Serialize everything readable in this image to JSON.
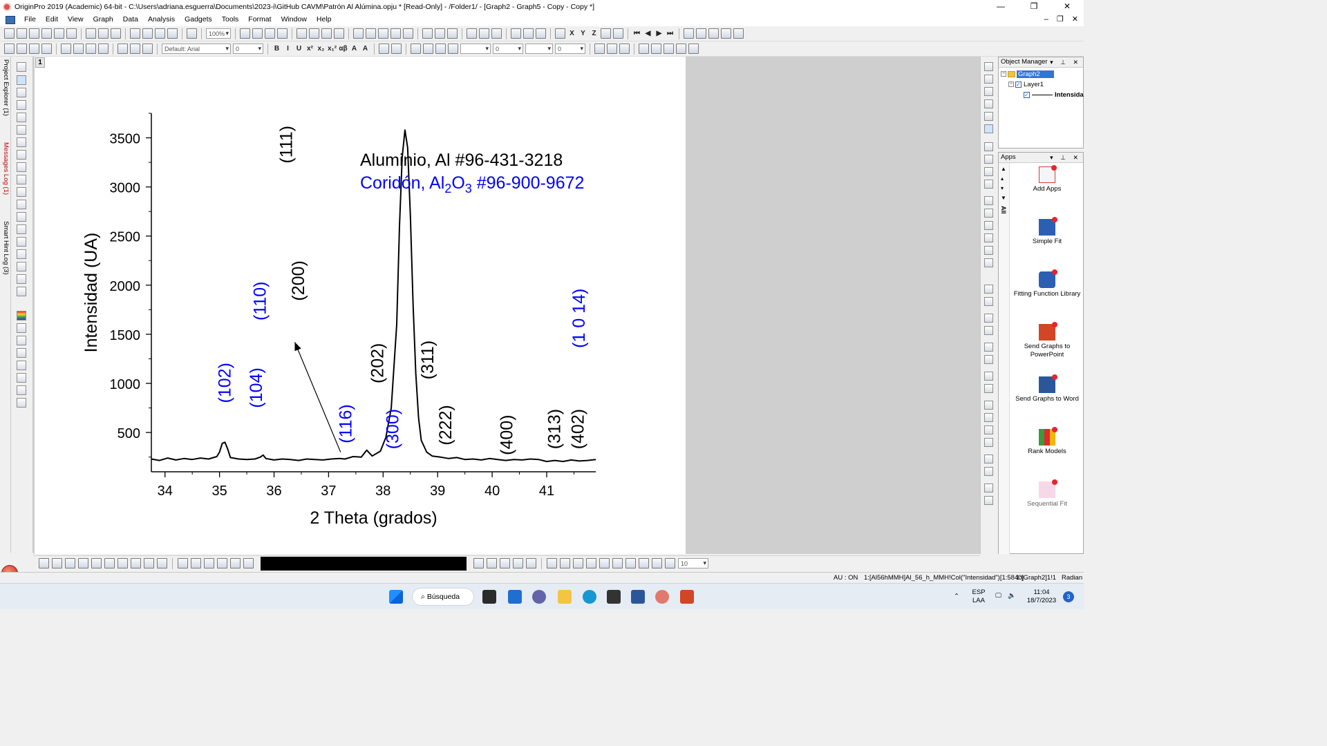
{
  "window": {
    "title": "OriginPro 2019 (Academic) 64-bit - C:\\Users\\adriana.esguerra\\Documents\\2023-i\\GitHub CAVM\\Patrón Al Alúmina.opju * [Read-Only] - /Folder1/ - [Graph2 - Graph5 - Copy - Copy *]",
    "controls": [
      "—",
      "❐",
      "✕"
    ]
  },
  "menu": {
    "items": [
      "File",
      "Edit",
      "View",
      "Graph",
      "Data",
      "Analysis",
      "Gadgets",
      "Tools",
      "Format",
      "Window",
      "Help"
    ],
    "mdi_controls": [
      "–",
      "❐",
      "✕"
    ]
  },
  "toolbar": {
    "zoom_value": "100%",
    "font_value": "Default: Arial",
    "font_size_value": "0",
    "line_width_value": "0",
    "line_width2_value": "0",
    "angle_value": "0",
    "format_glyphs": [
      "B",
      "I",
      "U",
      "x²",
      "x₂",
      "x₁²",
      "αβ",
      "A",
      "A"
    ]
  },
  "left_dock": {
    "tabs": [
      "Project Explorer (1)",
      "Messages Log (1)",
      "Smart Hint Log (3)"
    ]
  },
  "graph": {
    "layer_badge": "1",
    "chart_data": {
      "type": "line",
      "xlabel": "2 Theta (grados)",
      "ylabel": "Intensidad (UA)",
      "xlim": [
        33.75,
        41.9
      ],
      "ylim": [
        100,
        3750
      ],
      "x_ticks": [
        34,
        35,
        36,
        37,
        38,
        39,
        40,
        41
      ],
      "y_ticks": [
        500,
        1000,
        1500,
        2000,
        2500,
        3000,
        3500
      ],
      "series": [
        {
          "name": "Intensidad",
          "color": "#000000",
          "x": [
            33.75,
            33.9,
            34.05,
            34.2,
            34.35,
            34.5,
            34.65,
            34.8,
            34.95,
            35.0,
            35.05,
            35.1,
            35.15,
            35.2,
            35.35,
            35.5,
            35.65,
            35.75,
            35.8,
            35.85,
            36.0,
            36.15,
            36.3,
            36.45,
            36.6,
            36.75,
            36.9,
            37.05,
            37.2,
            37.3,
            37.45,
            37.6,
            37.7,
            37.8,
            37.95,
            38.05,
            38.15,
            38.25,
            38.3,
            38.35,
            38.4,
            38.45,
            38.5,
            38.55,
            38.6,
            38.65,
            38.7,
            38.8,
            38.9,
            39.05,
            39.2,
            39.35,
            39.5,
            39.65,
            39.8,
            39.95,
            40.1,
            40.25,
            40.4,
            40.55,
            40.7,
            40.85,
            41.0,
            41.15,
            41.3,
            41.45,
            41.6,
            41.75,
            41.9
          ],
          "y": [
            230,
            215,
            240,
            220,
            235,
            225,
            240,
            230,
            255,
            300,
            390,
            400,
            330,
            245,
            230,
            225,
            230,
            250,
            270,
            235,
            220,
            230,
            225,
            215,
            230,
            225,
            220,
            230,
            235,
            230,
            255,
            250,
            320,
            260,
            310,
            450,
            750,
            1600,
            2600,
            3300,
            3580,
            3400,
            2700,
            1800,
            1100,
            650,
            420,
            300,
            260,
            250,
            235,
            245,
            225,
            230,
            220,
            235,
            225,
            215,
            225,
            220,
            230,
            225,
            205,
            215,
            205,
            220,
            210,
            215,
            225
          ]
        }
      ],
      "legend": {
        "line1": "Aluminio, Al #96-431-3218",
        "line1_color": "#000000",
        "line2_parts": [
          "Coridón, Al",
          "2",
          "O",
          "3",
          " #96-900-9672"
        ],
        "line2_color": "#0000ff"
      },
      "annotations": [
        {
          "text": "(102)",
          "x": 35.2,
          "y": 800,
          "color": "#0000ff"
        },
        {
          "text": "(104)",
          "x": 35.78,
          "y": 750,
          "color": "#0000ff"
        },
        {
          "text": "(110)",
          "x": 35.85,
          "y": 1640,
          "color": "#0000ff"
        },
        {
          "text": "(111)",
          "x": 36.33,
          "y": 3240,
          "color": "#000000"
        },
        {
          "text": "(200)",
          "x": 36.55,
          "y": 1840,
          "color": "#000000"
        },
        {
          "text": "(116)",
          "x": 37.42,
          "y": 390,
          "color": "#0000ff"
        },
        {
          "text": "(202)",
          "x": 38.0,
          "y": 1000,
          "color": "#000000"
        },
        {
          "text": "(300)",
          "x": 38.28,
          "y": 330,
          "color": "#0000ff"
        },
        {
          "text": "(311)",
          "x": 38.92,
          "y": 1040,
          "color": "#000000"
        },
        {
          "text": "(222)",
          "x": 39.25,
          "y": 370,
          "color": "#000000"
        },
        {
          "text": "(400)",
          "x": 40.37,
          "y": 270,
          "color": "#000000"
        },
        {
          "text": "(313)",
          "x": 41.25,
          "y": 330,
          "color": "#000000"
        },
        {
          "text": "(402)",
          "x": 41.68,
          "y": 330,
          "color": "#000000"
        },
        {
          "text": "(1 0 14)",
          "x": 41.7,
          "y": 1360,
          "color": "#0000ff"
        }
      ],
      "arrow": {
        "from": [
          37.22,
          300
        ],
        "to": [
          36.38,
          1420
        ]
      }
    }
  },
  "object_manager": {
    "title": "Object Manager",
    "controls": "▾ ⊥ ✕",
    "root": "Graph2",
    "layer": "Layer1",
    "plot": "Intensida"
  },
  "apps_panel": {
    "title": "Apps",
    "controls": "▾ ⊥ ✕",
    "items": [
      {
        "label": "Add Apps",
        "color": "#d63b3b"
      },
      {
        "label": "Simple Fit",
        "color": "#2b5fb4"
      },
      {
        "label": "Fitting Function Library",
        "color": "#2b5fb4"
      },
      {
        "label": "Send Graphs to PowerPoint",
        "color": "#d24625"
      },
      {
        "label": "Send Graphs to Word",
        "color": "#2b579a"
      },
      {
        "label": "Rank Models",
        "color": "#3a9a3a"
      },
      {
        "label": "Sequential Fit",
        "color": "#d977a8"
      }
    ],
    "side_label": "All"
  },
  "bottom_toolbar": {
    "size_value": "10"
  },
  "status": {
    "au": "AU : ON",
    "column": "1:[Al56hMMH]Al_56_h_MMH!Col(\"Intensidad\")[1:5840]",
    "graph_ref": "1:[Graph2]1!1",
    "angle_unit": "Radian"
  },
  "taskbar": {
    "search": "Búsqueda",
    "lang_top": "ESP",
    "lang_bottom": "LAA",
    "time": "11:04",
    "date": "18/7/2023",
    "notifications": "3"
  }
}
